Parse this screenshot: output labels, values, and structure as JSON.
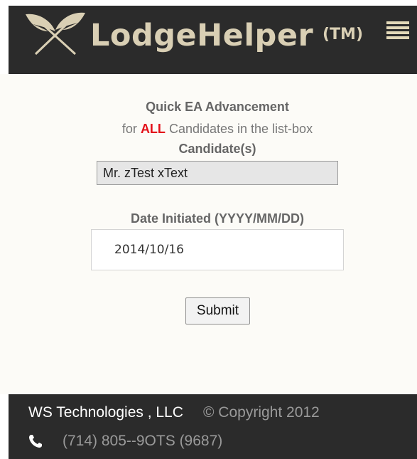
{
  "header": {
    "brand": "LodgeHelper",
    "trademark": "(TM)",
    "menu_icon": "hamburger-menu-icon",
    "logo_icon": "crossed-quills-icon",
    "colors": {
      "background": "#2b2b2b",
      "brand_text": "#d9cfb4"
    }
  },
  "form": {
    "title": "Quick EA Advancement",
    "subtitle_prefix": "for",
    "subtitle_emphasis": "ALL",
    "subtitle_suffix": "Candidates in the list-box",
    "candidates_label": "Candidate(s)",
    "candidates": [
      "Mr. zTest xText"
    ],
    "date_label": "Date Initiated (YYYY/MM/DD)",
    "date_value": "2014/10/16",
    "submit_label": "Submit",
    "colors": {
      "emphasis": "#e3101a"
    }
  },
  "footer": {
    "company": "WS Technologies , LLC",
    "copyright": "© Copyright 2012",
    "phone_icon": "phone-icon",
    "phone": "(714) 805--9OTS (9687)"
  }
}
